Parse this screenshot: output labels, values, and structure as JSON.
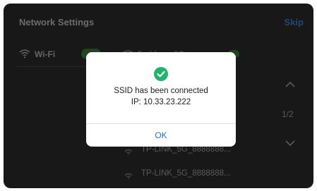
{
  "header": {
    "title": "Network Settings",
    "skip_label": "Skip"
  },
  "wifi": {
    "label": "Wi-Fi",
    "enabled": true,
    "icon": "wifi-icon"
  },
  "networks": {
    "top_partial": {
      "name": "flashforge 5G",
      "icon": "wifi-icon"
    },
    "items": [
      {
        "name": "TP-LINK_5G_8888888...",
        "icon": "wifi-icon"
      },
      {
        "name": "TP-LINK_5G_8888888...",
        "icon": "wifi-icon"
      }
    ]
  },
  "pager": {
    "text": "1/2",
    "up_icon": "chevron-up-icon",
    "down_icon": "chevron-down-icon"
  },
  "dialog": {
    "icon": "check-circle-icon",
    "message": "SSID has been connected",
    "ip": "IP: 10.33.23.222",
    "ok_label": "OK"
  },
  "colors": {
    "accent": "#2b70b8",
    "success": "#21b36b",
    "toggle_on": "#2f6d2f"
  }
}
